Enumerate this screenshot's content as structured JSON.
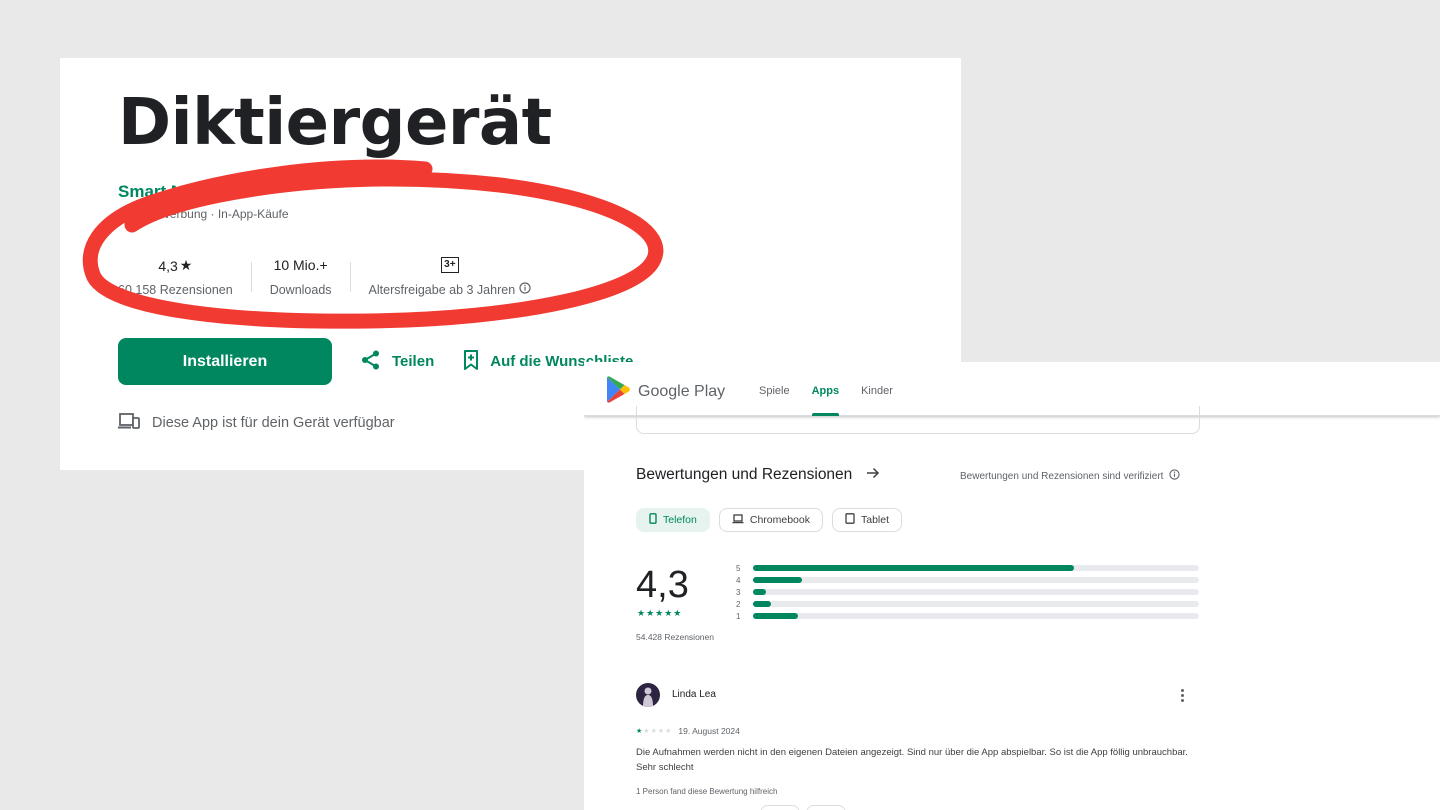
{
  "app_card": {
    "title": "Diktiergerät",
    "developer": "Smart Mobi",
    "in_app_note": "Enthält Werbung · In-App-Käufe",
    "stats": {
      "rating_value": "4,3",
      "rating_star": "★",
      "rating_label": "60.158 Rezensionen",
      "downloads_value": "10 Mio.+",
      "downloads_label": "Downloads",
      "age_badge": "3+",
      "age_label": "Altersfreigabe ab 3 Jahren"
    },
    "install_label": "Installieren",
    "share_label": "Teilen",
    "wishlist_label": "Auf die Wunschliste",
    "device_note": "Diese App ist für dein Gerät verfügbar"
  },
  "annotation": {
    "color": "#f13a32"
  },
  "play_card": {
    "brand": "Google Play",
    "nav": [
      {
        "label": "Spiele",
        "active": false
      },
      {
        "label": "Apps",
        "active": true
      },
      {
        "label": "Kinder",
        "active": false
      }
    ],
    "section_title": "Bewertungen und Rezensionen",
    "verified_note": "Bewertungen und Rezensionen sind verifiziert",
    "chips": [
      {
        "label": "Telefon",
        "active": true
      },
      {
        "label": "Chromebook",
        "active": false
      },
      {
        "label": "Tablet",
        "active": false
      }
    ],
    "rating": "4,3",
    "rating_stars": "★★★★★",
    "review_count": "54.428 Rezensionen",
    "histogram": [
      {
        "label": "5",
        "fraction": 0.72
      },
      {
        "label": "4",
        "fraction": 0.11
      },
      {
        "label": "3",
        "fraction": 0.03
      },
      {
        "label": "2",
        "fraction": 0.04
      },
      {
        "label": "1",
        "fraction": 0.1
      }
    ],
    "review": {
      "author": "Linda Lea",
      "stars": 1,
      "date": "19. August 2024",
      "text": "Die Aufnahmen werden nicht in den eigenen Dateien angezeigt. Sind nur über die App abspielbar. So ist die App föllig unbrauchbar. Sehr schlecht",
      "helpful": "1 Person fand diese Bewertung hilfreich"
    }
  },
  "colors": {
    "accent": "#01875f",
    "background": "#e8e9e8"
  }
}
